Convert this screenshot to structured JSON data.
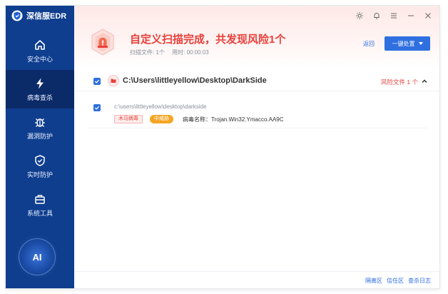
{
  "app": {
    "name": "深信服EDR"
  },
  "sidebar": {
    "items": [
      {
        "label": "安全中心",
        "icon": "home-icon"
      },
      {
        "label": "病毒查杀",
        "icon": "lightning-icon",
        "active": true
      },
      {
        "label": "漏洞防护",
        "icon": "bug-icon"
      },
      {
        "label": "实时防护",
        "icon": "shield-icon"
      },
      {
        "label": "系统工具",
        "icon": "toolbox-icon"
      }
    ],
    "ai_label": "AI"
  },
  "header": {
    "title": "自定义扫描完成，共发现风险1个",
    "scanned_files": "扫描文件: 1个",
    "elapsed": "用时: 00:00:03",
    "back_label": "返回",
    "action_label": "一键处置",
    "icon": "alarm-icon"
  },
  "colors": {
    "sidebar": "#0f3e8e",
    "accent": "#2f6fe0",
    "danger": "#e8403a",
    "warning": "#f5a524"
  },
  "results": {
    "group": {
      "path": "C:\\Users\\littleyellow\\Desktop\\DarkSide",
      "risk_count": "风险文件 1 个",
      "checked": true
    },
    "files": [
      {
        "path": "c:\\users\\littleyellow\\desktop\\darkside",
        "type_tag": "木马病毒",
        "level_tag": "中威胁",
        "virus_name": "病毒名称：Trojan.Win32.Ymacco.AA9C",
        "checked": true
      }
    ]
  },
  "footer": {
    "links": [
      "隔离区",
      "信任区",
      "查杀日志"
    ]
  }
}
